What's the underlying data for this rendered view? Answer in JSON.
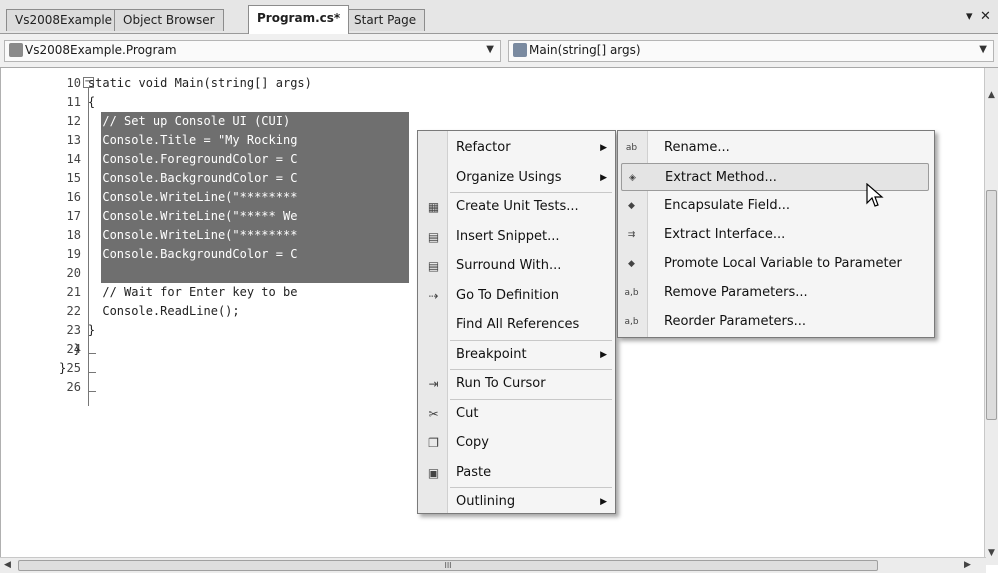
{
  "tabs": [
    {
      "label": "Vs2008Example",
      "active": false
    },
    {
      "label": "Object Browser",
      "active": false
    },
    {
      "label": "Program.cs*",
      "active": true
    },
    {
      "label": "Start Page",
      "active": false
    }
  ],
  "tab_controls": {
    "dropdown": "▾",
    "close": "✕"
  },
  "nav": {
    "class_combo": "Vs2008Example.Program",
    "member_combo": "Main(string[] args)"
  },
  "code_lines": [
    {
      "num": "10",
      "text": "    static void Main(string[] args)"
    },
    {
      "num": "11",
      "text": "    {"
    },
    {
      "num": "12",
      "text": "      // Set up Console UI (CUI)"
    },
    {
      "num": "13",
      "text": "      Console.Title = \"My Rocking"
    },
    {
      "num": "14",
      "text": "      Console.ForegroundColor = C"
    },
    {
      "num": "15",
      "text": "      Console.BackgroundColor = C"
    },
    {
      "num": "16",
      "text": "      Console.WriteLine(\"********"
    },
    {
      "num": "17",
      "text": "      Console.WriteLine(\"***** We"
    },
    {
      "num": "18",
      "text": "      Console.WriteLine(\"********"
    },
    {
      "num": "19",
      "text": "      Console.BackgroundColor = C"
    },
    {
      "num": "20",
      "text": ""
    },
    {
      "num": "21",
      "text": "      // Wait for Enter key to be"
    },
    {
      "num": "22",
      "text": "      Console.ReadLine();"
    },
    {
      "num": "23",
      "text": "    }"
    },
    {
      "num": "24",
      "text": "  }"
    },
    {
      "num": "25",
      "text": "}"
    },
    {
      "num": "26",
      "text": ""
    }
  ],
  "outline_markers": {
    "collapse": "−"
  },
  "context_menu": {
    "items": [
      {
        "label": "Refactor",
        "icon": "",
        "submenu": true
      },
      {
        "label": "Organize Usings",
        "icon": "",
        "submenu": true
      },
      {
        "label": "Create Unit Tests...",
        "icon": "unit-test-icon",
        "submenu": false
      },
      {
        "label": "Insert Snippet...",
        "icon": "insert-snippet-icon",
        "submenu": false
      },
      {
        "label": "Surround With...",
        "icon": "surround-with-icon",
        "submenu": false
      },
      {
        "label": "Go To Definition",
        "icon": "go-to-definition-icon",
        "submenu": false
      },
      {
        "label": "Find All References",
        "icon": "",
        "submenu": false
      },
      {
        "label": "Breakpoint",
        "icon": "",
        "submenu": true
      },
      {
        "label": "Run To Cursor",
        "icon": "run-to-cursor-icon",
        "submenu": false
      },
      {
        "label": "Cut",
        "icon": "cut-icon",
        "submenu": false
      },
      {
        "label": "Copy",
        "icon": "copy-icon",
        "submenu": false
      },
      {
        "label": "Paste",
        "icon": "paste-icon",
        "submenu": false
      },
      {
        "label": "Outlining",
        "icon": "",
        "submenu": true
      }
    ],
    "submenu_arrow": "▶"
  },
  "refactor_menu": {
    "items": [
      {
        "label": "Rename...",
        "icon": "rename-icon",
        "glyph": "ab"
      },
      {
        "label": "Extract Method...",
        "icon": "extract-method-icon",
        "glyph": "◈"
      },
      {
        "label": "Encapsulate Field...",
        "icon": "encapsulate-field-icon",
        "glyph": "◆"
      },
      {
        "label": "Extract Interface...",
        "icon": "extract-interface-icon",
        "glyph": "⇉"
      },
      {
        "label": "Promote Local Variable to Parameter",
        "icon": "promote-variable-icon",
        "glyph": "◆"
      },
      {
        "label": "Remove Parameters...",
        "icon": "remove-parameters-icon",
        "glyph": "a,b"
      },
      {
        "label": "Reorder Parameters...",
        "icon": "reorder-parameters-icon",
        "glyph": "a,b"
      }
    ],
    "hovered": "Extract Method..."
  },
  "hscroll": {
    "grip": "III"
  },
  "scroll_arrows": {
    "up": "▲",
    "down": "▼",
    "left": "◀",
    "right": "▶"
  },
  "colors": {
    "selection": "#6f6f6f",
    "menu_bg": "#f5f5f5",
    "hover": "#e4e4e4"
  }
}
